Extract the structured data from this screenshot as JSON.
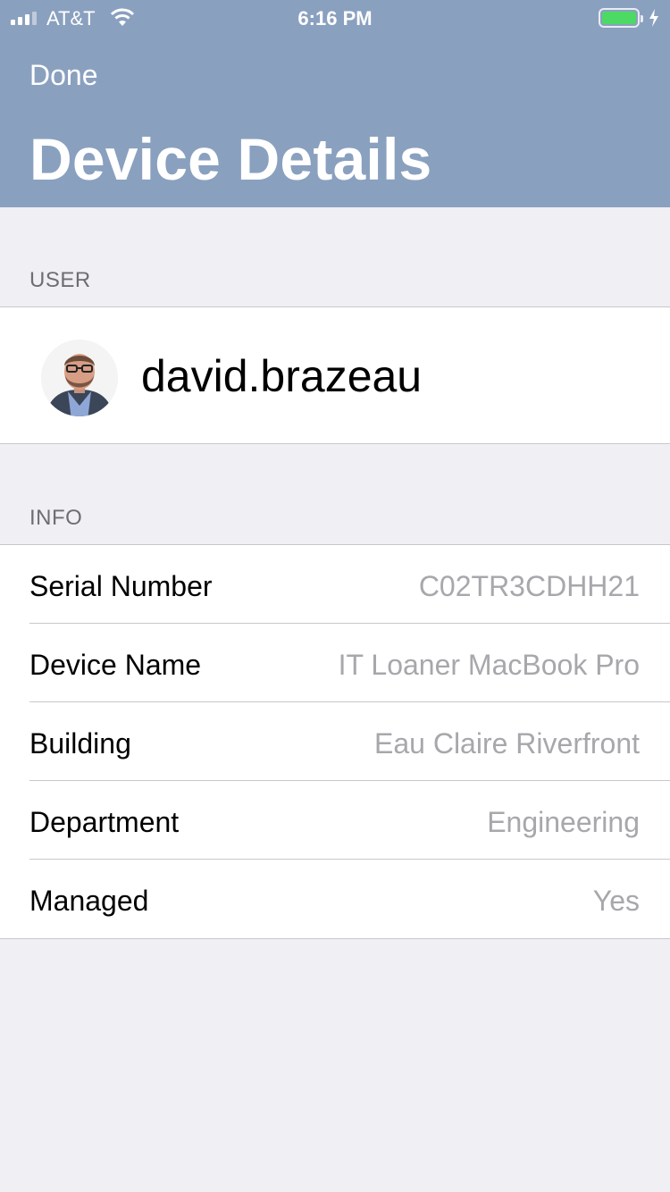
{
  "status_bar": {
    "carrier": "AT&T",
    "time": "6:16 PM",
    "battery_color": "#4cd964"
  },
  "nav": {
    "done_label": "Done",
    "title": "Device Details"
  },
  "user_section": {
    "header": "USER",
    "username": "david.brazeau",
    "avatar_icon": "user-avatar"
  },
  "info_section": {
    "header": "INFO",
    "rows": [
      {
        "label": "Serial Number",
        "value": "C02TR3CDHH21"
      },
      {
        "label": "Device Name",
        "value": "IT Loaner MacBook Pro"
      },
      {
        "label": "Building",
        "value": "Eau Claire Riverfront"
      },
      {
        "label": "Department",
        "value": "Engineering"
      },
      {
        "label": "Managed",
        "value": "Yes"
      }
    ]
  },
  "colors": {
    "header_bg": "#8aa0bf",
    "page_bg": "#efeff4",
    "value_text": "#a7a7ac"
  }
}
